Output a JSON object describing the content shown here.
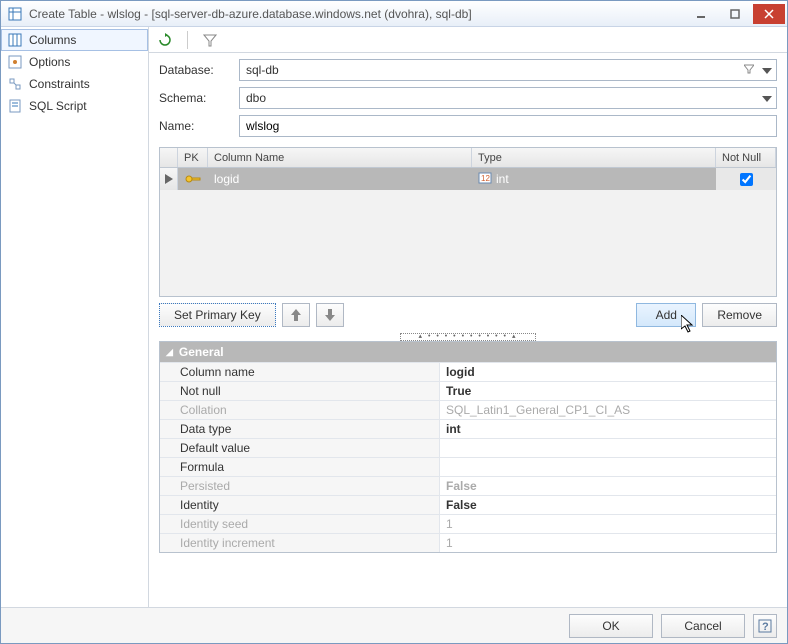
{
  "title": "Create Table - wlslog - [sql-server-db-azure.database.windows.net (dvohra), sql-db]",
  "sidebar": {
    "items": [
      {
        "label": "Columns",
        "selected": true
      },
      {
        "label": "Options",
        "selected": false
      },
      {
        "label": "Constraints",
        "selected": false
      },
      {
        "label": "SQL Script",
        "selected": false
      }
    ]
  },
  "form": {
    "database_label": "Database:",
    "database_value": "sql-db",
    "schema_label": "Schema:",
    "schema_value": "dbo",
    "name_label": "Name:",
    "name_value": "wlslog"
  },
  "grid": {
    "headers": {
      "pk": "PK",
      "name": "Column Name",
      "type": "Type",
      "notnull": "Not Null"
    },
    "rows": [
      {
        "is_pk": true,
        "name": "logid",
        "type": "int",
        "notnull": true
      }
    ]
  },
  "buttons": {
    "set_pk": "Set Primary Key",
    "add": "Add",
    "remove": "Remove",
    "ok": "OK",
    "cancel": "Cancel"
  },
  "props": {
    "title": "General",
    "rows": [
      {
        "name": "Column name",
        "value": "logid",
        "bold": true,
        "disabled": false
      },
      {
        "name": "Not null",
        "value": "True",
        "bold": true,
        "disabled": false
      },
      {
        "name": "Collation",
        "value": "SQL_Latin1_General_CP1_CI_AS",
        "bold": false,
        "disabled": true
      },
      {
        "name": "Data type",
        "value": "int",
        "bold": true,
        "disabled": false
      },
      {
        "name": "Default value",
        "value": "",
        "bold": false,
        "disabled": false
      },
      {
        "name": "Formula",
        "value": "",
        "bold": false,
        "disabled": false
      },
      {
        "name": "Persisted",
        "value": "False",
        "bold": true,
        "disabled": true
      },
      {
        "name": "Identity",
        "value": "False",
        "bold": true,
        "disabled": false
      },
      {
        "name": "Identity seed",
        "value": "1",
        "bold": false,
        "disabled": true
      },
      {
        "name": "Identity increment",
        "value": "1",
        "bold": false,
        "disabled": true
      }
    ]
  }
}
